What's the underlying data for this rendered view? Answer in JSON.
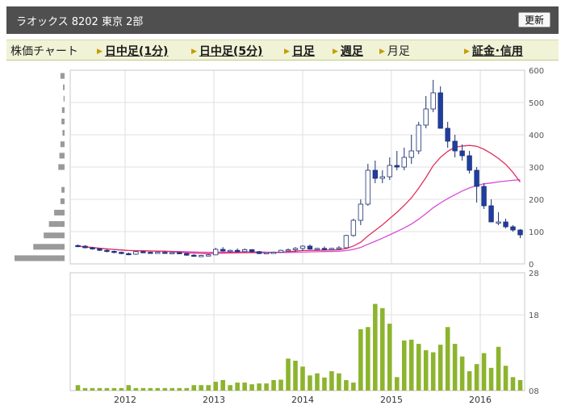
{
  "header": {
    "title": "ラオックス  8202  東京 2部",
    "refresh_label": "更新"
  },
  "nav": {
    "chart_label": "株価チャート",
    "items": [
      {
        "label": "日中足(1分)",
        "active": true
      },
      {
        "label": "日中足(5分)",
        "active": true
      },
      {
        "label": "日足",
        "active": true
      },
      {
        "label": "週足",
        "active": true
      },
      {
        "label": "月足",
        "active": false
      },
      {
        "label": "証金･信用",
        "active": true
      }
    ]
  },
  "chart_data": {
    "type": "candlestick",
    "x_ticks": [
      "2012",
      "2013",
      "2014",
      "2015",
      "2016"
    ],
    "price_axis": {
      "ticks": [
        "600",
        "500",
        "400",
        "300",
        "200",
        "100",
        "0"
      ],
      "ylim": [
        0,
        600
      ]
    },
    "volume_axis": {
      "ticks": [
        "28",
        "18",
        "08"
      ],
      "ylim": [
        0,
        28
      ]
    },
    "colors": {
      "up": "#ffffff",
      "down": "#1f3ea0",
      "ma_short": "#e0305a",
      "ma_long": "#d84ad8",
      "volume": "#8cb42e",
      "volume_profile": "#9a9a9a"
    },
    "candles": [
      [
        57,
        60,
        52,
        55
      ],
      [
        55,
        58,
        48,
        50
      ],
      [
        50,
        53,
        44,
        47
      ],
      [
        47,
        49,
        40,
        42
      ],
      [
        42,
        45,
        36,
        39
      ],
      [
        39,
        41,
        33,
        36
      ],
      [
        36,
        38,
        30,
        32
      ],
      [
        32,
        35,
        27,
        30
      ],
      [
        30,
        40,
        28,
        38
      ],
      [
        38,
        40,
        34,
        36
      ],
      [
        36,
        38,
        33,
        34
      ],
      [
        34,
        37,
        32,
        36
      ],
      [
        36,
        38,
        33,
        34
      ],
      [
        34,
        37,
        32,
        35
      ],
      [
        35,
        37,
        30,
        32
      ],
      [
        32,
        34,
        25,
        27
      ],
      [
        27,
        30,
        23,
        25
      ],
      [
        25,
        28,
        22,
        26
      ],
      [
        26,
        30,
        24,
        28
      ],
      [
        28,
        50,
        27,
        45
      ],
      [
        45,
        52,
        38,
        40
      ],
      [
        40,
        44,
        35,
        42
      ],
      [
        42,
        48,
        36,
        38
      ],
      [
        38,
        48,
        36,
        44
      ],
      [
        44,
        46,
        35,
        38
      ],
      [
        38,
        40,
        30,
        32
      ],
      [
        32,
        36,
        30,
        35
      ],
      [
        35,
        38,
        32,
        36
      ],
      [
        36,
        44,
        34,
        42
      ],
      [
        42,
        48,
        40,
        44
      ],
      [
        44,
        52,
        38,
        48
      ],
      [
        48,
        58,
        40,
        55
      ],
      [
        55,
        60,
        44,
        46
      ],
      [
        46,
        50,
        42,
        48
      ],
      [
        48,
        54,
        44,
        46
      ],
      [
        46,
        50,
        42,
        48
      ],
      [
        48,
        55,
        44,
        50
      ],
      [
        50,
        90,
        48,
        88
      ],
      [
        88,
        140,
        84,
        135
      ],
      [
        135,
        200,
        120,
        185
      ],
      [
        185,
        310,
        180,
        290
      ],
      [
        290,
        320,
        250,
        265
      ],
      [
        265,
        290,
        250,
        270
      ],
      [
        270,
        330,
        260,
        305
      ],
      [
        305,
        350,
        290,
        300
      ],
      [
        300,
        360,
        290,
        330
      ],
      [
        330,
        400,
        310,
        350
      ],
      [
        350,
        440,
        340,
        430
      ],
      [
        430,
        520,
        420,
        480
      ],
      [
        480,
        570,
        470,
        530
      ],
      [
        530,
        550,
        420,
        420
      ],
      [
        420,
        440,
        360,
        380
      ],
      [
        380,
        400,
        330,
        350
      ],
      [
        350,
        370,
        320,
        335
      ],
      [
        335,
        350,
        280,
        290
      ],
      [
        290,
        300,
        190,
        240
      ],
      [
        240,
        250,
        170,
        180
      ],
      [
        180,
        200,
        140,
        130
      ],
      [
        130,
        160,
        120,
        130
      ],
      [
        130,
        140,
        110,
        115
      ],
      [
        115,
        120,
        100,
        105
      ],
      [
        105,
        108,
        80,
        90
      ]
    ],
    "volume": [
      1.3,
      0.6,
      0.6,
      0.6,
      0.6,
      0.6,
      0.6,
      1.3,
      0.6,
      0.6,
      0.6,
      0.6,
      0.6,
      0.6,
      0.6,
      0.6,
      1.3,
      1.3,
      1.3,
      2.1,
      2.5,
      1.3,
      1.9,
      1.9,
      1.5,
      1.7,
      1.7,
      2.5,
      2.6,
      7.6,
      7.1,
      5.7,
      3.6,
      4.1,
      3.1,
      4.6,
      4.1,
      2.5,
      1.9,
      14.6,
      15.1,
      20.6,
      19.6,
      15.9,
      3.2,
      11.9,
      12.1,
      11.1,
      9.6,
      9.1,
      10.9,
      15.1,
      11.1,
      8.1,
      4.6,
      6.3,
      8.9,
      5.4,
      10.4,
      5.9,
      3.2,
      2.5,
      1.2
    ],
    "volume_profile": [
      96,
      60,
      40,
      30,
      20,
      8,
      6,
      0,
      12,
      10,
      8,
      4,
      6,
      5,
      2,
      3,
      8
    ]
  }
}
